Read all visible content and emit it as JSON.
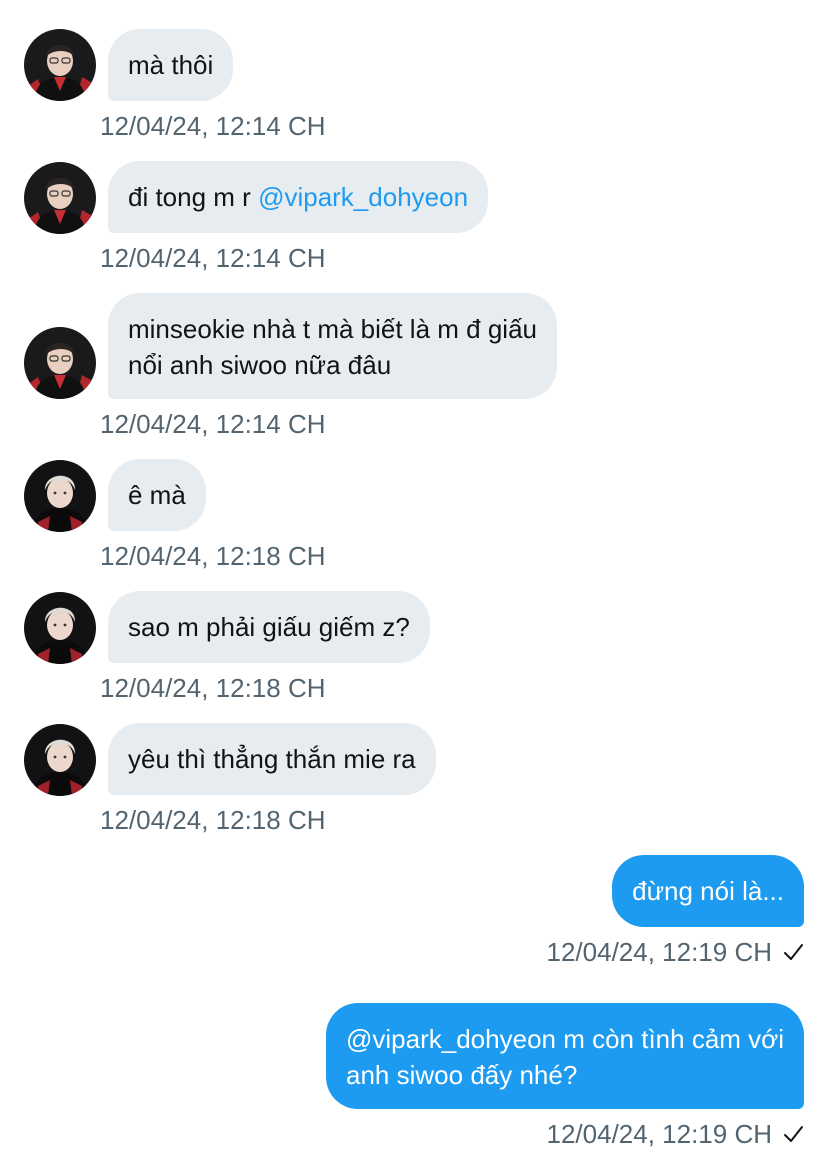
{
  "messages": [
    {
      "direction": "in",
      "avatar": "avatar-1",
      "text": "mà thôi",
      "timestamp": "12/04/24, 12:14 CH"
    },
    {
      "direction": "in",
      "avatar": "avatar-1",
      "text_prefix": "đi tong m r ",
      "mention": "@vipark_dohyeon",
      "timestamp": "12/04/24, 12:14 CH"
    },
    {
      "direction": "in",
      "avatar": "avatar-1",
      "line1": "minseokie nhà t mà biết là m đ giấu",
      "line2": "nổi anh siwoo nữa đâu",
      "timestamp": "12/04/24, 12:14 CH"
    },
    {
      "direction": "in",
      "avatar": "avatar-2",
      "text": "ê mà",
      "timestamp": "12/04/24, 12:18 CH"
    },
    {
      "direction": "in",
      "avatar": "avatar-2",
      "text": "sao m phải giấu giếm z?",
      "timestamp": "12/04/24, 12:18 CH"
    },
    {
      "direction": "in",
      "avatar": "avatar-2",
      "text": "yêu thì thẳng thắn mie ra",
      "timestamp": "12/04/24, 12:18 CH"
    },
    {
      "direction": "out",
      "text": "đừng nói là...",
      "timestamp": "12/04/24, 12:19 CH",
      "status_icon": "check-icon"
    },
    {
      "direction": "out",
      "line1": "@vipark_dohyeon m còn tình cảm với",
      "line2": "anh siwoo đấy nhé?",
      "timestamp": "12/04/24, 12:19 CH",
      "status_icon": "check-icon"
    }
  ],
  "colors": {
    "incoming_bubble": "#e7ecf0",
    "outgoing_bubble": "#1d9bf0",
    "mention": "#1d9bf0",
    "timestamp": "#536471"
  }
}
